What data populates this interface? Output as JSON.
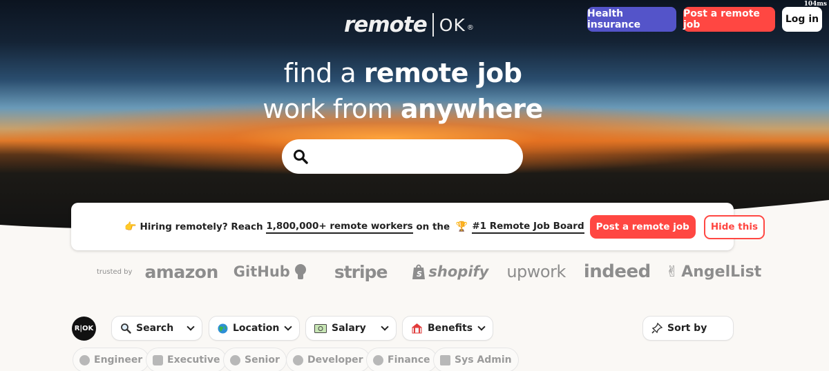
{
  "perf_tag": "104ms",
  "logo": {
    "remote": "remote",
    "ok": "OK",
    "reg": "®"
  },
  "header": {
    "health_label": "Health insurance",
    "post_job_label": "Post a remote job",
    "login_label": "Log in"
  },
  "hero": {
    "line1_plain": "find a ",
    "line1_bold": "remote job",
    "line2_plain": "work from ",
    "line2_bold": "anywhere",
    "search_placeholder": ""
  },
  "banner": {
    "emoji_hand": "👉",
    "text_pre": "Hiring remotely? Reach ",
    "workers_link": "1,800,000+ remote workers",
    "text_mid": " on the ",
    "emoji_trophy": "🏆",
    "board_link": "#1 Remote Job Board",
    "post_label": "Post a remote job",
    "hide_label": "Hide this"
  },
  "trusted": {
    "label": "trusted by",
    "brands": [
      "amazon",
      "GitHub",
      "stripe",
      "shopify",
      "upwork",
      "indeed",
      "AngelList"
    ]
  },
  "filters": {
    "ok_badge": "R|OK",
    "search": "Search",
    "location": "Location",
    "salary": "Salary",
    "benefits": "Benefits",
    "sort": "Sort by"
  },
  "tags": [
    "Engineer",
    "Executive",
    "Senior",
    "Developer",
    "Finance",
    "Sys Admin"
  ],
  "colors": {
    "accent_red": "#ff4742",
    "accent_purple": "#5454c9"
  }
}
